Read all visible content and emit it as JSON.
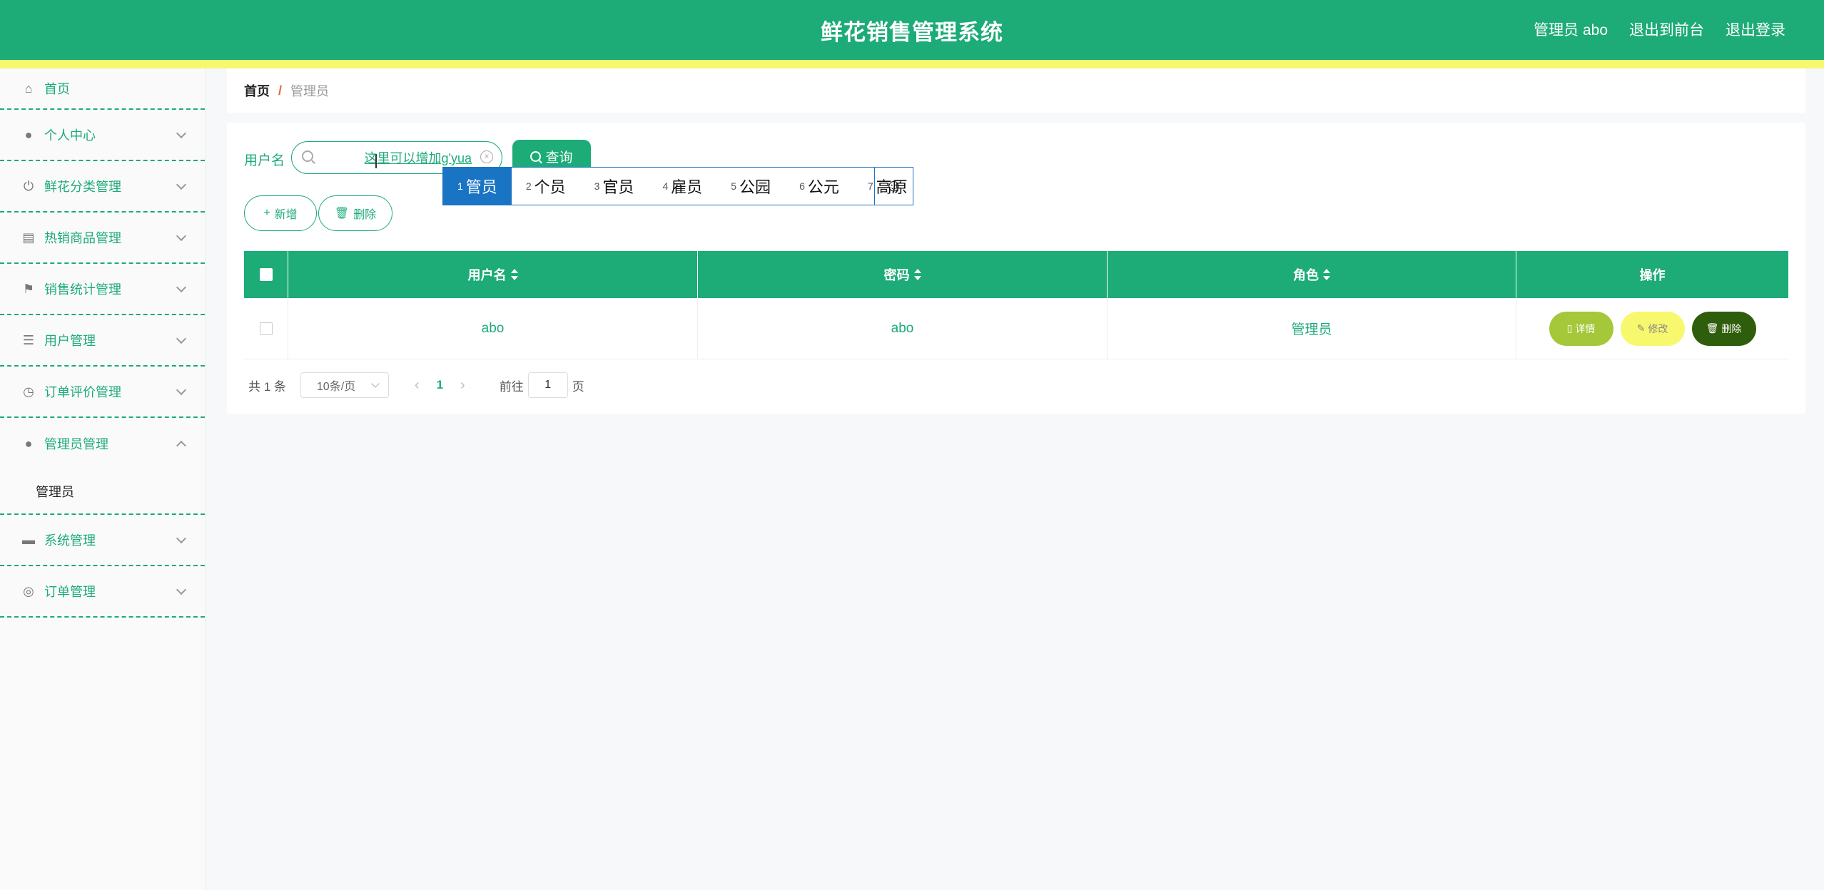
{
  "header": {
    "title": "鲜花销售管理系统",
    "user_label": "管理员 abo",
    "to_front_label": "退出到前台",
    "logout_label": "退出登录"
  },
  "sidebar": {
    "items": [
      {
        "label": "首页",
        "icon": "home-icon"
      },
      {
        "label": "个人中心",
        "icon": "user-icon"
      },
      {
        "label": "鲜花分类管理",
        "icon": "power-icon"
      },
      {
        "label": "热销商品管理",
        "icon": "clipboard-icon"
      },
      {
        "label": "销售统计管理",
        "icon": "flag-icon"
      },
      {
        "label": "用户管理",
        "icon": "list-icon"
      },
      {
        "label": "订单评价管理",
        "icon": "compass-icon"
      },
      {
        "label": "管理员管理",
        "icon": "user-icon",
        "submenu": "管理员"
      },
      {
        "label": "系统管理",
        "icon": "monitor-icon"
      },
      {
        "label": "订单管理",
        "icon": "lifebuoy-icon"
      }
    ]
  },
  "breadcrumb": {
    "home": "首页",
    "separator": "/",
    "current": "管理员"
  },
  "search": {
    "label": "用户名",
    "value": "这里可以增加g'yua",
    "query_label": "查询"
  },
  "ime": {
    "candidates": [
      {
        "num": "1",
        "text": "管员"
      },
      {
        "num": "2",
        "text": "个员"
      },
      {
        "num": "3",
        "text": "官员"
      },
      {
        "num": "4",
        "text": "雇员"
      },
      {
        "num": "5",
        "text": "公园"
      },
      {
        "num": "6",
        "text": "公元"
      },
      {
        "num": "7",
        "text": "高原"
      }
    ],
    "emoji": "☺"
  },
  "actions": {
    "add_label": "新增",
    "delete_label": "删除"
  },
  "table": {
    "headers": [
      "用户名",
      "密码",
      "角色",
      "操作"
    ],
    "rows": [
      {
        "username": "abo",
        "password": "abo",
        "role": "管理员"
      }
    ],
    "row_actions": {
      "detail": "详情",
      "edit": "修改",
      "delete": "删除"
    }
  },
  "pagination": {
    "total": "共 1 条",
    "page_size": "10条/页",
    "current_page": "1",
    "goto_label": "前往",
    "goto_value": "1",
    "page_suffix": "页"
  },
  "colors": {
    "primary": "#1dab78",
    "stripe": "#f8f86e",
    "detail": "#a4c83a",
    "edit": "#f8f86e",
    "danger": "#2e5d0b",
    "ime": "#1a74c4"
  }
}
